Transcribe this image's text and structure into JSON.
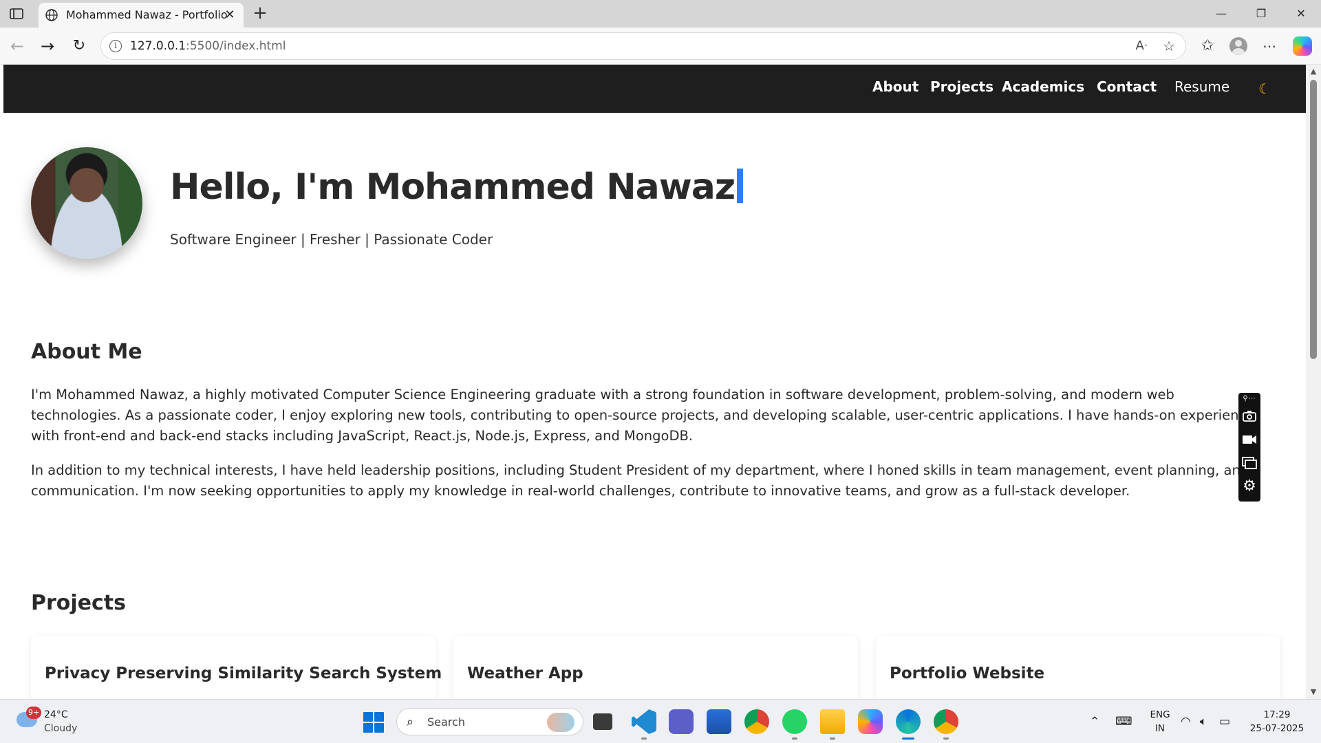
{
  "browser": {
    "tab_title": "Mohammed Nawaz - Portfolio",
    "url_host": "127.0.0.1",
    "url_rest": ":5500/index.html",
    "window_controls": {
      "minimize": "—",
      "restore": "❐",
      "close": "✕"
    }
  },
  "site_nav": {
    "items": [
      {
        "label": "About"
      },
      {
        "label": "Projects"
      },
      {
        "label": "Academics"
      },
      {
        "label": "Contact"
      },
      {
        "label": "Resume"
      }
    ],
    "theme_toggle_icon": "moon-icon"
  },
  "hero": {
    "title": "Hello, I'm Mohammed Nawaz",
    "subtitle": "Software Engineer | Fresher | Passionate Coder"
  },
  "about": {
    "heading": "About Me",
    "paragraphs": [
      "I'm Mohammed Nawaz, a highly motivated Computer Science Engineering graduate with a strong foundation in software development, problem-solving, and modern web technologies. As a passionate coder, I enjoy exploring new tools, contributing to open-source projects, and developing scalable, user-centric applications. I have hands-on experience with front-end and back-end stacks including JavaScript, React.js, Node.js, Express, and MongoDB.",
      "In addition to my technical interests, I have held leadership positions, including Student President of my department, where I honed skills in team management, event planning, and communication. I'm now seeking opportunities to apply my knowledge in real-world challenges, contribute to innovative teams, and grow as a full-stack developer."
    ]
  },
  "projects": {
    "heading": "Projects",
    "cards": [
      {
        "title": "Privacy Preserving Similarity Search System"
      },
      {
        "title": "Weather App"
      },
      {
        "title": "Portfolio Website"
      }
    ]
  },
  "taskbar": {
    "weather_temp": "24°C",
    "weather_condition": "Cloudy",
    "weather_badge": "9+",
    "search_label": "Search",
    "language_line1": "ENG",
    "language_line2": "IN",
    "time": "17:29",
    "date": "25-07-2025"
  },
  "colors": {
    "nav_background": "#1e1e1e",
    "accent_caret": "#2f7df6",
    "moon": "#ffb300"
  }
}
